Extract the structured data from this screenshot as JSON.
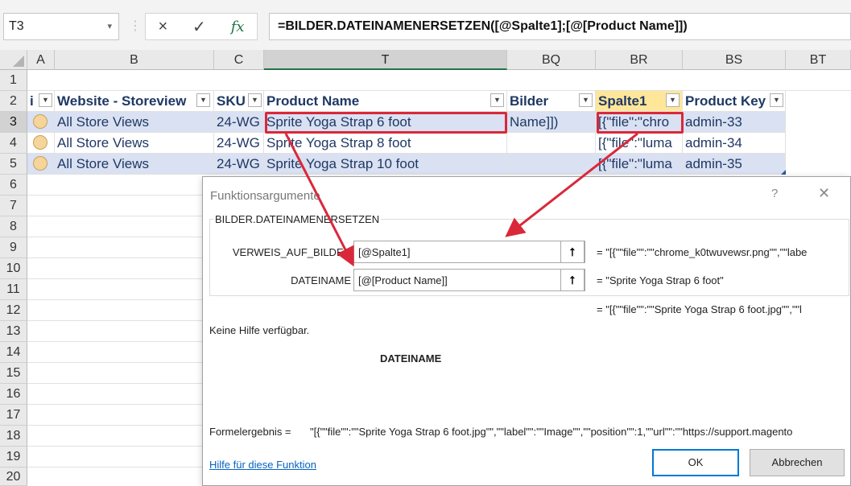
{
  "formula_bar": {
    "name_box": "T3",
    "cancel_icon": "×",
    "enter_icon": "✓",
    "fx_label": "fx",
    "formula": "=BILDER.DATEINAMENERSETZEN([@Spalte1];[@[Product Name]])"
  },
  "columns": [
    "A",
    "B",
    "C",
    "T",
    "BQ",
    "BR",
    "BS",
    "BT"
  ],
  "rows": [
    "1",
    "2",
    "3",
    "4",
    "5",
    "6",
    "7",
    "8",
    "9",
    "10",
    "11",
    "12",
    "13",
    "14",
    "15",
    "16",
    "17",
    "18",
    "19",
    "20"
  ],
  "table": {
    "headers": {
      "a": "i",
      "b": "Website - Storeview",
      "c": "SKU",
      "t": "Product Name",
      "bq": "Bilder",
      "br": "Spalte1",
      "bs": "Product Key"
    },
    "rows": [
      {
        "website": "All Store Views",
        "sku": "24-WG",
        "name": "Sprite Yoga Strap 6 foot",
        "bilder": "Name]])",
        "spalte1": "[{\"file\":\"chro",
        "key": "admin-33"
      },
      {
        "website": "All Store Views",
        "sku": "24-WG",
        "name": "Sprite Yoga Strap 8 foot",
        "bilder": "",
        "spalte1": "[{\"file\":\"luma",
        "key": "admin-34"
      },
      {
        "website": "All Store Views",
        "sku": "24-WG",
        "name": "Sprite Yoga Strap 10 foot",
        "bilder": "",
        "spalte1": "[{\"file\":\"luma",
        "key": "admin-35"
      }
    ]
  },
  "dialog": {
    "title": "Funktionsargumente",
    "help_icon": "?",
    "close_icon": "✕",
    "function_name": "BILDER.DATEINAMENERSETZEN",
    "arg1_label": "VERWEIS_AUF_BILDER",
    "arg1_value": "[@Spalte1]",
    "arg1_result": "=   \"[{\"\"file\"\":\"\"chrome_k0twuvewsr.png\"\",\"\"labe",
    "arg2_label": "DATEINAME",
    "arg2_value": "[@[Product Name]]",
    "arg2_result": "=   \"Sprite Yoga Strap 6 foot\"",
    "ref_icon": "⭡",
    "function_result": "=   \"[{\"\"file\"\":\"\"Sprite Yoga Strap 6 foot.jpg\"\",\"\"l",
    "no_help": "Keine Hilfe verfügbar.",
    "current_arg": "DATEINAME",
    "formula_result_label": "Formelergebnis =",
    "formula_result_value": "\"[{\"\"file\"\":\"\"Sprite Yoga Strap 6 foot.jpg\"\",\"\"label\"\":\"\"Image\"\",\"\"position\"\":1,\"\"url\"\":\"\"https://support.magento",
    "help_link": "Hilfe für diese Funktion",
    "ok": "OK",
    "cancel": "Abbrechen"
  },
  "colors": {
    "band": "#d9e1f2",
    "header_text": "#1f3864",
    "highlight": "#d9283a",
    "selected_header": "#ffe699"
  }
}
